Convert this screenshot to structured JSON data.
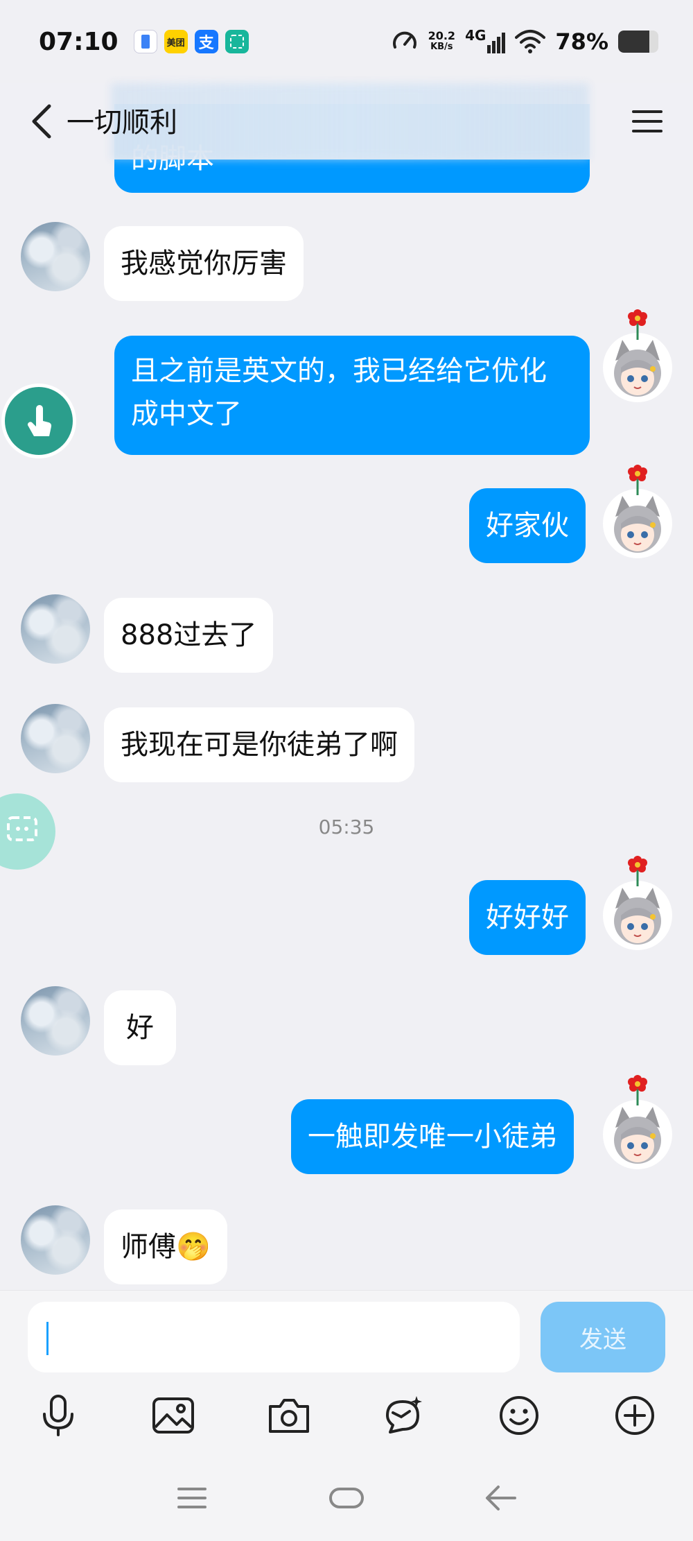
{
  "status_bar": {
    "time": "07:10",
    "app_icons": [
      "phone-app-icon",
      "meituan-app-icon",
      "alipay-app-icon",
      "scanner-app-icon"
    ],
    "meituan_label": "美团",
    "alipay_label": "支",
    "net_speed_value": "20.2",
    "net_speed_unit": "KB/s",
    "network_type": "4G",
    "battery_percent": "78%",
    "battery_level": 0.78
  },
  "header": {
    "title": "一切顺利",
    "back_icon": "chevron-left-icon",
    "menu_icon": "hamburger-menu-icon"
  },
  "messages": [
    {
      "side": "out",
      "text": "的脚本",
      "partial": true
    },
    {
      "side": "in",
      "text": "我感觉你厉害"
    },
    {
      "side": "out",
      "text": "且之前是英文的，我已经给它优化成中文了"
    },
    {
      "side": "out",
      "text": "好家伙"
    },
    {
      "side": "in",
      "text": "888过去了"
    },
    {
      "side": "in",
      "text": "我现在可是你徒弟了啊"
    },
    {
      "side": "out",
      "text": "好好好"
    },
    {
      "side": "in",
      "text": "好"
    },
    {
      "side": "out",
      "text": "一触即发唯一小徒弟"
    },
    {
      "side": "in",
      "text": "师傅🤭"
    }
  ],
  "timestamp": "05:35",
  "input": {
    "value": "",
    "send_label": "发送"
  },
  "toolbar_icons": [
    "microphone-icon",
    "image-icon",
    "camera-icon",
    "ai-chat-icon",
    "emoji-icon",
    "plus-icon"
  ],
  "nav_icons": [
    "recents-icon",
    "home-icon",
    "back-icon"
  ],
  "colors": {
    "outgoing_bubble": "#0099ff",
    "incoming_bubble": "#ffffff",
    "background": "#f0f0f4",
    "send_button": "#7cc6f7"
  }
}
